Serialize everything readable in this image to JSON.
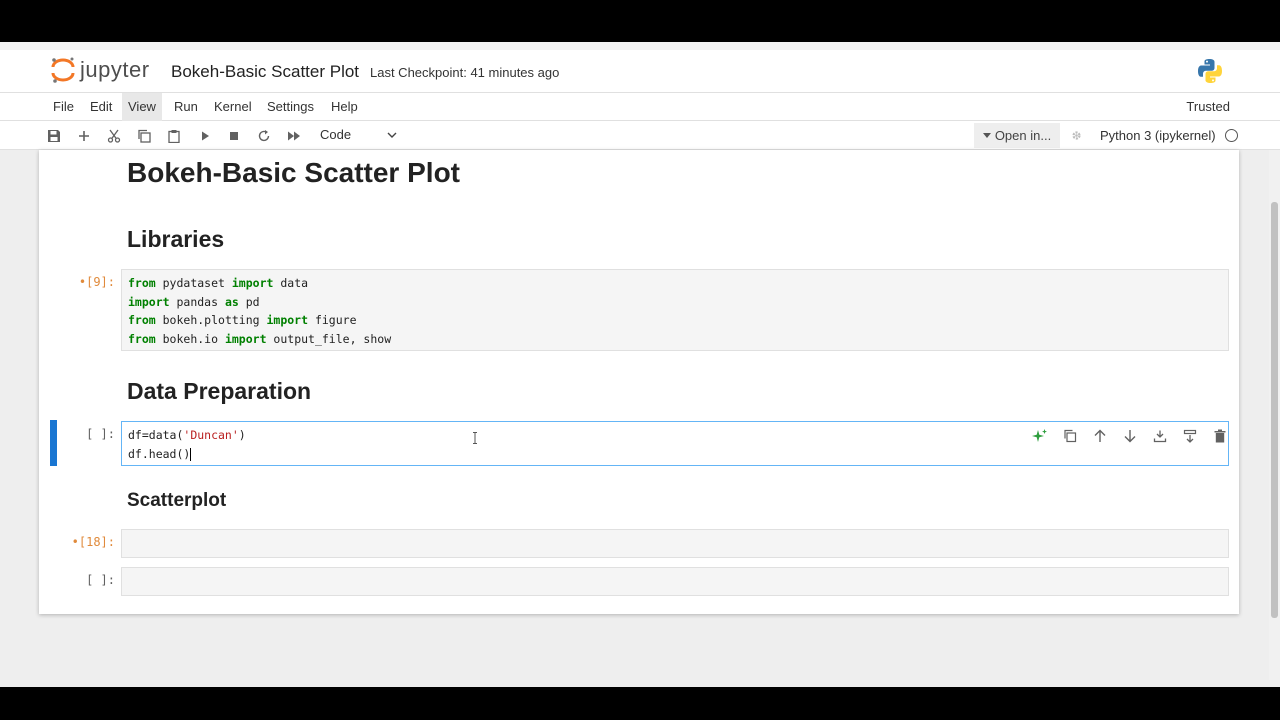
{
  "app": {
    "logo_text": "jupyter",
    "notebook_title": "Bokeh-Basic Scatter Plot",
    "checkpoint": "Last Checkpoint: 41 minutes ago",
    "trusted": "Trusted"
  },
  "menu": {
    "items": [
      {
        "label": "File"
      },
      {
        "label": "Edit"
      },
      {
        "label": "View"
      },
      {
        "label": "Run"
      },
      {
        "label": "Kernel"
      },
      {
        "label": "Settings"
      },
      {
        "label": "Help"
      }
    ]
  },
  "toolbar": {
    "icons": [
      "save-icon",
      "add-icon",
      "cut-icon",
      "copy-icon",
      "paste-icon",
      "run-icon",
      "stop-icon",
      "restart-icon",
      "fast-forward-icon"
    ],
    "cell_type": "Code",
    "open_in": "Open in...",
    "kernel": "Python 3 (ipykernel)"
  },
  "notebook": {
    "title_heading": "Bokeh-Basic Scatter Plot",
    "libraries_heading": "Libraries",
    "data_prep_heading": "Data Preparation",
    "scatterplot_heading": "Scatterplot",
    "cells": {
      "c1_prompt": "•[9]:",
      "c2_prompt": "[ ]:",
      "c3_prompt": "•[18]:",
      "c4_prompt": "[ ]:"
    },
    "code1": {
      "l1_a": "from",
      "l1_b": " pydataset ",
      "l1_c": "import",
      "l1_d": " data",
      "l2_a": "import",
      "l2_b": " pandas ",
      "l2_c": "as",
      "l2_d": " pd",
      "l3_a": "from",
      "l3_b": " bokeh.plotting ",
      "l3_c": "import",
      "l3_d": " figure",
      "l4_a": "from",
      "l4_b": " bokeh.io ",
      "l4_c": "import",
      "l4_d": " output_file, show"
    },
    "code2": {
      "l1_a": "df=data(",
      "l1_b": "'Duncan'",
      "l1_c": ")",
      "l2_a": "df.head()"
    }
  },
  "colors": {
    "accent": "#1976d2",
    "exec_prompt": "#e08a3b",
    "keyword": "#008000",
    "string": "#ba2121"
  }
}
